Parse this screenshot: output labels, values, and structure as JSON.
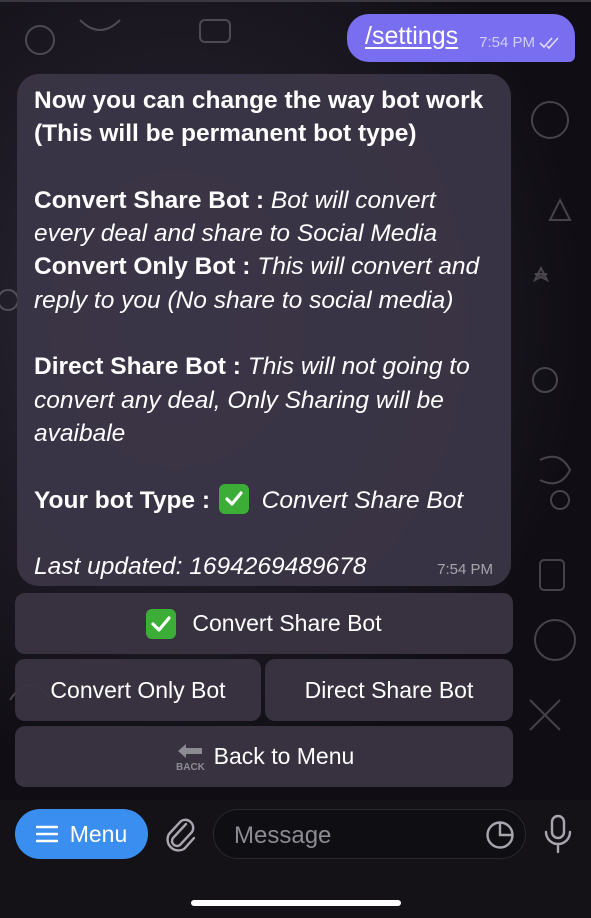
{
  "outgoing": {
    "text": "/settings",
    "time": "7:54 PM"
  },
  "incoming": {
    "line1": "Now you can change the way bot work",
    "line2": "(This will be permanent bot type)",
    "convert_share_label": "Convert Share Bot :",
    "convert_share_desc_1": "Bot will convert",
    "convert_share_desc_2": "every deal and share to Social Media",
    "convert_only_label": "Convert Only Bot :",
    "convert_only_desc_1": "This will convert and",
    "convert_only_desc_2": "reply to you (No share to social media)",
    "direct_share_label": "Direct Share Bot :",
    "direct_share_desc_1": "This will not going to",
    "direct_share_desc_2": "convert any deal, Only Sharing will be",
    "direct_share_desc_3": "avaibale",
    "bot_type_label": "Your bot Type :",
    "bot_type_value": "Convert Share Bot",
    "last_updated": "Last updated: 1694269489678",
    "time": "7:54 PM"
  },
  "keyboard": {
    "convert_share": "Convert Share Bot",
    "convert_only": "Convert Only Bot",
    "direct_share": "Direct Share Bot",
    "back_to_menu": "Back to Menu",
    "back_icon_text": "BACK"
  },
  "input_bar": {
    "menu_label": "Menu",
    "placeholder": "Message"
  },
  "colors": {
    "outgoing_bubble": "#7a6ef0",
    "menu_button": "#3a8ef0",
    "check_emoji": "#3cae38"
  }
}
